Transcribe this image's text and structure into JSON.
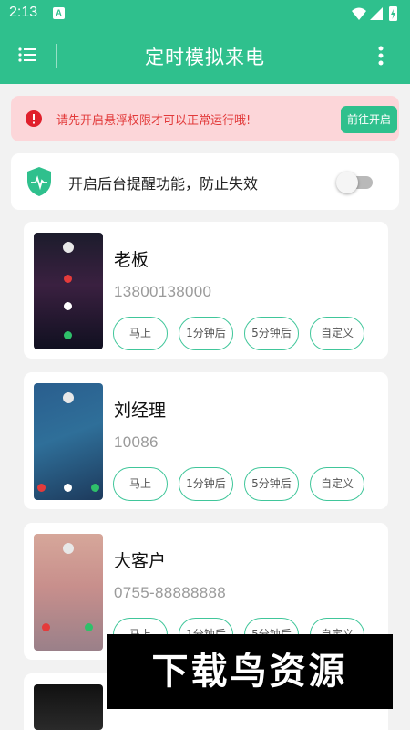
{
  "status_bar": {
    "time": "2:13",
    "notification_glyph": "A",
    "icons": [
      "wifi-icon",
      "signal-icon",
      "battery-charging-icon"
    ]
  },
  "app_bar": {
    "title": "定时模拟来电",
    "menu_icon": "menu-icon",
    "more_icon": "more-vertical-icon"
  },
  "alert": {
    "message": "请先开启悬浮权限才可以正常运行哦!",
    "button_label": "前往开启",
    "icon": "error-icon"
  },
  "reminder": {
    "label": "开启后台提醒功能，防止失效",
    "toggle_on": false,
    "icon": "shield-pulse-icon"
  },
  "buttons": {
    "now": "马上",
    "one_min": "1分钟后",
    "five_min": "5分钟后",
    "custom": "自定义"
  },
  "contacts": [
    {
      "name": "老板",
      "phone": "13800138000"
    },
    {
      "name": "刘经理",
      "phone": "10086"
    },
    {
      "name": "大客户",
      "phone": "0755-88888888"
    }
  ],
  "watermark": {
    "text": "下载鸟资源"
  },
  "colors": {
    "accent": "#2fc08d",
    "alert_bg": "#fcd6d9",
    "alert_text": "#e23a3a",
    "button_border": "#40c69a"
  }
}
